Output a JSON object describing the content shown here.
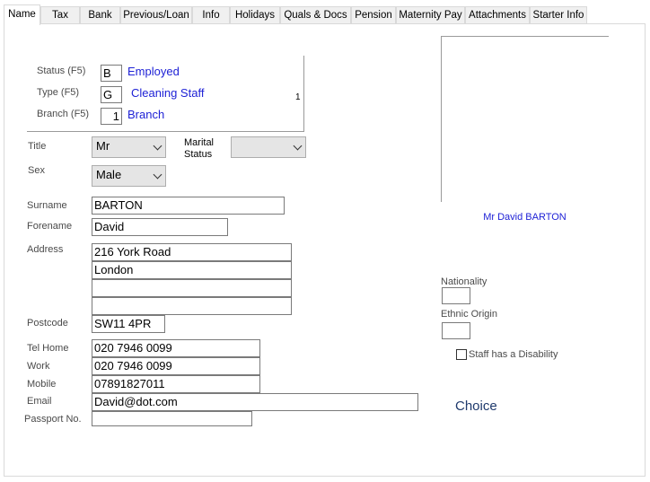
{
  "tabs": [
    "Name",
    "Tax",
    "Bank",
    "Previous/Loan",
    "Info",
    "Holidays",
    "Quals & Docs",
    "Pension",
    "Maternity Pay",
    "Attachments",
    "Starter Info"
  ],
  "employment": {
    "status_label": "Status (F5)",
    "status_code": "B",
    "status_value": "Employed",
    "type_label": "Type   (F5)",
    "type_code": "G",
    "type_value": "Cleaning Staff",
    "branch_label": "Branch (F5)",
    "branch_code": "1",
    "branch_value": "Branch",
    "side_number": "1"
  },
  "title": {
    "label": "Title",
    "value": "Mr"
  },
  "marital": {
    "label_line1": "Marital",
    "label_line2": "Status",
    "value": ""
  },
  "sex": {
    "label": "Sex",
    "value": "Male"
  },
  "surname": {
    "label": "Surname",
    "value": "BARTON"
  },
  "forename": {
    "label": "Forename",
    "value": "David"
  },
  "address": {
    "label": "Address",
    "lines": [
      "216 York Road",
      "London",
      "",
      ""
    ]
  },
  "postcode": {
    "label": "Postcode",
    "value": "SW11 4PR"
  },
  "tel_home": {
    "label": "Tel Home",
    "value": "020 7946 0099"
  },
  "work": {
    "label": "Work",
    "value": "020 7946 0099"
  },
  "mobile": {
    "label": "Mobile",
    "value": "07891827011"
  },
  "email": {
    "label": "Email",
    "value": "David@dot.com"
  },
  "passport": {
    "label": "Passport No.",
    "value": ""
  },
  "photo_caption": "Mr David BARTON",
  "nationality": {
    "label": "Nationality",
    "value": ""
  },
  "ethnic": {
    "label": "Ethnic Origin",
    "value": ""
  },
  "disability": {
    "label": "Staff has a Disability",
    "checked": false
  },
  "choice_text": "Choice",
  "colors": {
    "accent_blue": "#1f22d6",
    "border": "#7a7a7a"
  }
}
